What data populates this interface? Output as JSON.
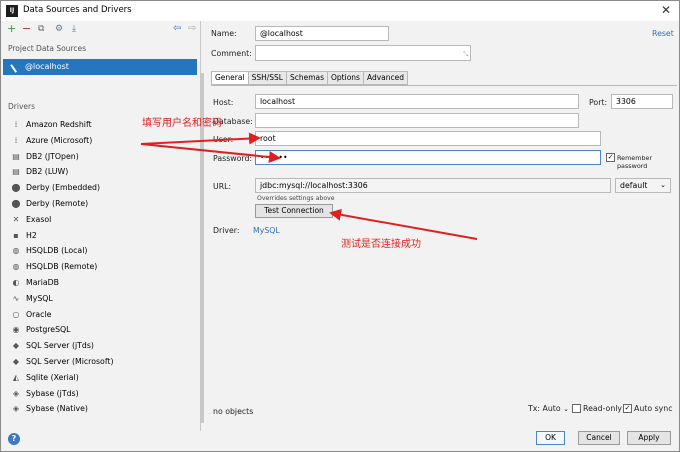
{
  "window": {
    "title": "Data Sources and Drivers"
  },
  "left": {
    "project_label": "Project Data Sources",
    "selected_source": "@localhost",
    "drivers_label": "Drivers",
    "drivers": [
      {
        "name": "Amazon Redshift",
        "icon": "⁞"
      },
      {
        "name": "Azure (Microsoft)",
        "icon": "⁞"
      },
      {
        "name": "DB2 (JTOpen)",
        "icon": "▤"
      },
      {
        "name": "DB2 (LUW)",
        "icon": "▤"
      },
      {
        "name": "Derby (Embedded)",
        "icon": "⬤"
      },
      {
        "name": "Derby (Remote)",
        "icon": "⬤"
      },
      {
        "name": "Exasol",
        "icon": "✕"
      },
      {
        "name": "H2",
        "icon": "▪"
      },
      {
        "name": "HSQLDB (Local)",
        "icon": "◍"
      },
      {
        "name": "HSQLDB (Remote)",
        "icon": "◍"
      },
      {
        "name": "MariaDB",
        "icon": "◐"
      },
      {
        "name": "MySQL",
        "icon": "∿"
      },
      {
        "name": "Oracle",
        "icon": "○"
      },
      {
        "name": "PostgreSQL",
        "icon": "◉"
      },
      {
        "name": "SQL Server (jTds)",
        "icon": "◆"
      },
      {
        "name": "SQL Server (Microsoft)",
        "icon": "◆"
      },
      {
        "name": "Sqlite (Xerial)",
        "icon": "◭"
      },
      {
        "name": "Sybase (jTds)",
        "icon": "◈"
      },
      {
        "name": "Sybase (Native)",
        "icon": "◈"
      }
    ]
  },
  "form": {
    "name_label": "Name:",
    "name_value": "@localhost",
    "comment_label": "Comment:",
    "reset": "Reset",
    "tabs": [
      "General",
      "SSH/SSL",
      "Schemas",
      "Options",
      "Advanced"
    ],
    "host_label": "Host:",
    "host_value": "localhost",
    "port_label": "Port:",
    "port_value": "3306",
    "database_label": "Database:",
    "user_label": "User:",
    "user_value": "root",
    "password_label": "Password:",
    "password_value": "••••••",
    "remember_label": "Remember password",
    "url_label": "URL:",
    "url_value": "jdbc:mysql://localhost:3306",
    "url_mode": "default",
    "overrides": "Overrides settings above",
    "test_button": "Test Connection",
    "driver_label": "Driver:",
    "driver_value": "MySQL",
    "no_objects": "no objects",
    "tx": "Tx: Auto",
    "read_only": "Read-only",
    "auto_sync": "Auto sync"
  },
  "buttons": {
    "ok": "OK",
    "cancel": "Cancel",
    "apply": "Apply"
  },
  "annotations": {
    "fill_user": "填写用户名和密码",
    "test_success": "测试是否连接成功"
  },
  "colors": {
    "selection": "#2675bf",
    "annotation": "#e02020",
    "link": "#2e6fbb"
  }
}
